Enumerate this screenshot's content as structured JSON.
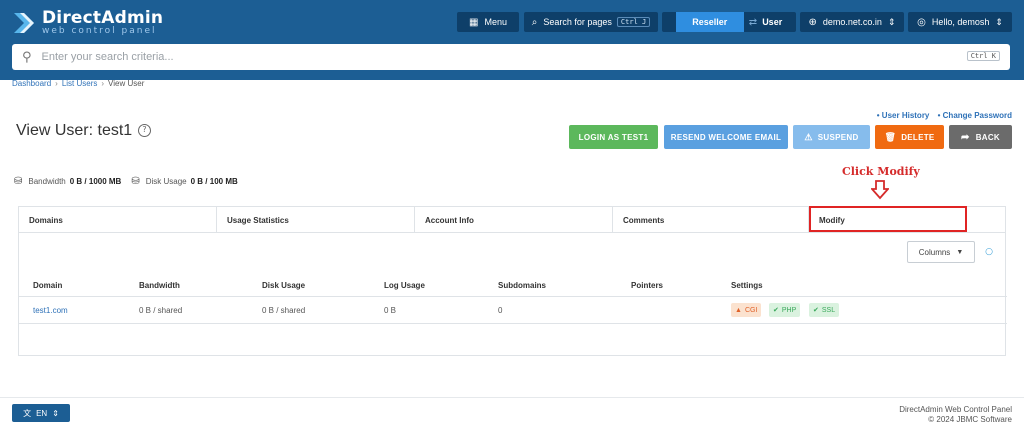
{
  "brand": {
    "title": "DirectAdmin",
    "subtitle": "web control panel"
  },
  "header": {
    "menu_label": "Menu",
    "search_pages_label": "Search for pages",
    "search_pages_kbd": "Ctrl J",
    "reseller_label": "Reseller",
    "user_label": "User",
    "domain_label": "demo.net.co.in",
    "hello_label": "Hello, demosh"
  },
  "search": {
    "placeholder": "Enter your search criteria...",
    "kbd": "Ctrl K"
  },
  "breadcrumb": [
    "Dashboard",
    "List Users",
    "View User"
  ],
  "page": {
    "title": "View User: test1"
  },
  "links": {
    "history": "• User History",
    "password": "• Change Password"
  },
  "actions": {
    "login": "LOGIN AS TEST1",
    "resend": "RESEND WELCOME EMAIL",
    "suspend": "SUSPEND",
    "delete": "DELETE",
    "back": "BACK"
  },
  "stats": {
    "bandwidth_label": "Bandwidth",
    "bandwidth_value": "0 B / 1000 MB",
    "disk_label": "Disk Usage",
    "disk_value": "0 B / 100 MB"
  },
  "annotation": {
    "text": "Click Modify"
  },
  "tabs": [
    "Domains",
    "Usage Statistics",
    "Account Info",
    "Comments",
    "Modify"
  ],
  "table": {
    "columns_button": "Columns",
    "headers": [
      "Domain",
      "Bandwidth",
      "Disk Usage",
      "Log Usage",
      "Subdomains",
      "Pointers",
      "Settings"
    ],
    "rows": [
      {
        "domain": "test1.com",
        "bandwidth": "0 B / shared",
        "disk": "0 B / shared",
        "log": "0 B",
        "subdomains": "0",
        "pointers": "",
        "badges": [
          "CGI",
          "PHP",
          "SSL"
        ]
      }
    ]
  },
  "footer": {
    "lang": "EN",
    "line1": "DirectAdmin Web Control Panel",
    "line2": "© 2024 JBMC Software"
  },
  "colors": {
    "header": "#1c5e94",
    "green": "#5cb85c",
    "blue": "#5aa0e0",
    "orange": "#f06a11",
    "grey": "#6b6b6b",
    "highlight": "#e02424"
  }
}
